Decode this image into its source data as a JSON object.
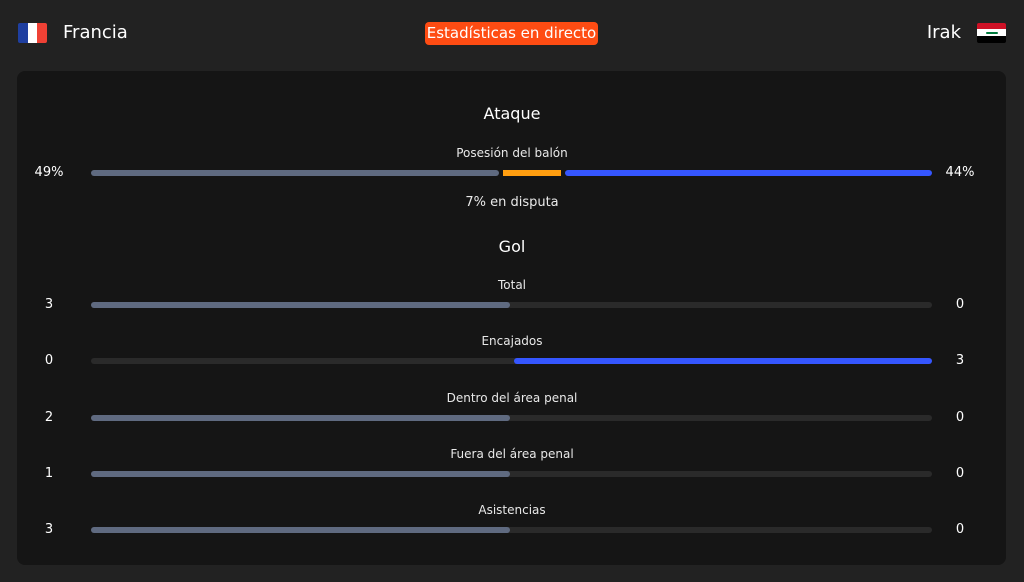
{
  "header": {
    "home_team": "Francia",
    "away_team": "Irak",
    "live_label": "Estadísticas en directo"
  },
  "colors": {
    "home_bar": "#5f6a80",
    "away_bar": "#3556ff",
    "contested": "#ff9e10",
    "live_badge": "#ff4c13"
  },
  "icons": {
    "home_flag": "france-flag-icon",
    "away_flag": "iraq-flag-icon"
  },
  "attack": {
    "title": "Ataque",
    "possession": {
      "label": "Posesión del balón",
      "home_display": "49%",
      "away_display": "44%",
      "home_pct": 49,
      "contested_pct": 7,
      "away_pct": 44,
      "dispute_label": "7% en disputa"
    }
  },
  "goals": {
    "title": "Gol",
    "stats": [
      {
        "label": "Total",
        "home": "3",
        "away": "0"
      },
      {
        "label": "Encajados",
        "home": "0",
        "away": "3"
      },
      {
        "label": "Dentro del área penal",
        "home": "2",
        "away": "0"
      },
      {
        "label": "Fuera del área penal",
        "home": "1",
        "away": "0"
      },
      {
        "label": "Asistencias",
        "home": "3",
        "away": "0"
      }
    ]
  }
}
